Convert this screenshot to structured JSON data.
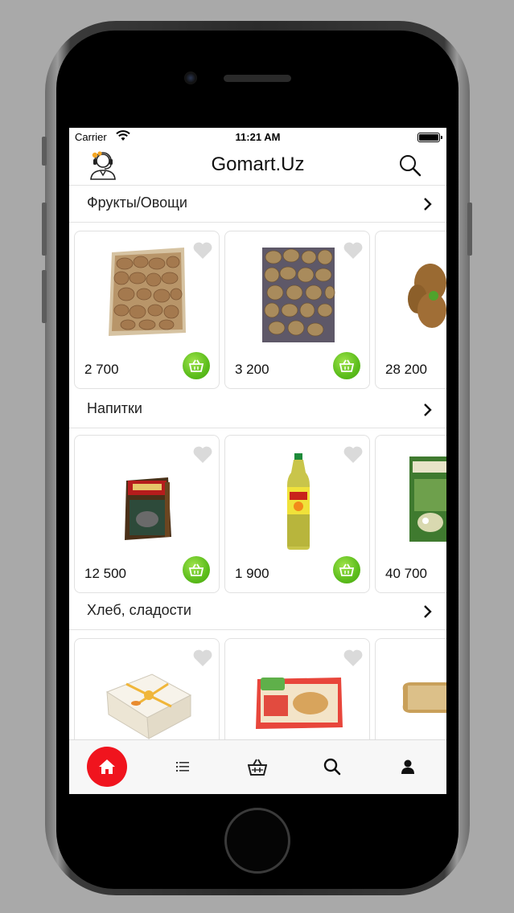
{
  "status_bar": {
    "carrier": "Carrier",
    "time": "11:21 AM"
  },
  "header": {
    "title": "Gomart.Uz",
    "support_icon": "support-agent-icon",
    "search_icon": "search-icon"
  },
  "sections": [
    {
      "title": "Фрукты/Овощи",
      "products": [
        {
          "price": "2 700"
        },
        {
          "price": "3 200"
        },
        {
          "price": "28 200"
        }
      ]
    },
    {
      "title": "Напитки",
      "products": [
        {
          "price": "12 500"
        },
        {
          "price": "1 900"
        },
        {
          "price": "40 700"
        }
      ]
    },
    {
      "title": "Хлеб, сладости",
      "products": [
        {
          "price": ""
        },
        {
          "price": ""
        },
        {
          "price": ""
        }
      ]
    }
  ],
  "tab_bar": {
    "items": [
      "home-icon",
      "list-icon",
      "basket-icon",
      "search-icon",
      "profile-icon"
    ],
    "active": "home-icon",
    "active_color": "#f0141e"
  },
  "colors": {
    "accent_green": "#5cbd1c",
    "accent_red": "#f0141e"
  }
}
